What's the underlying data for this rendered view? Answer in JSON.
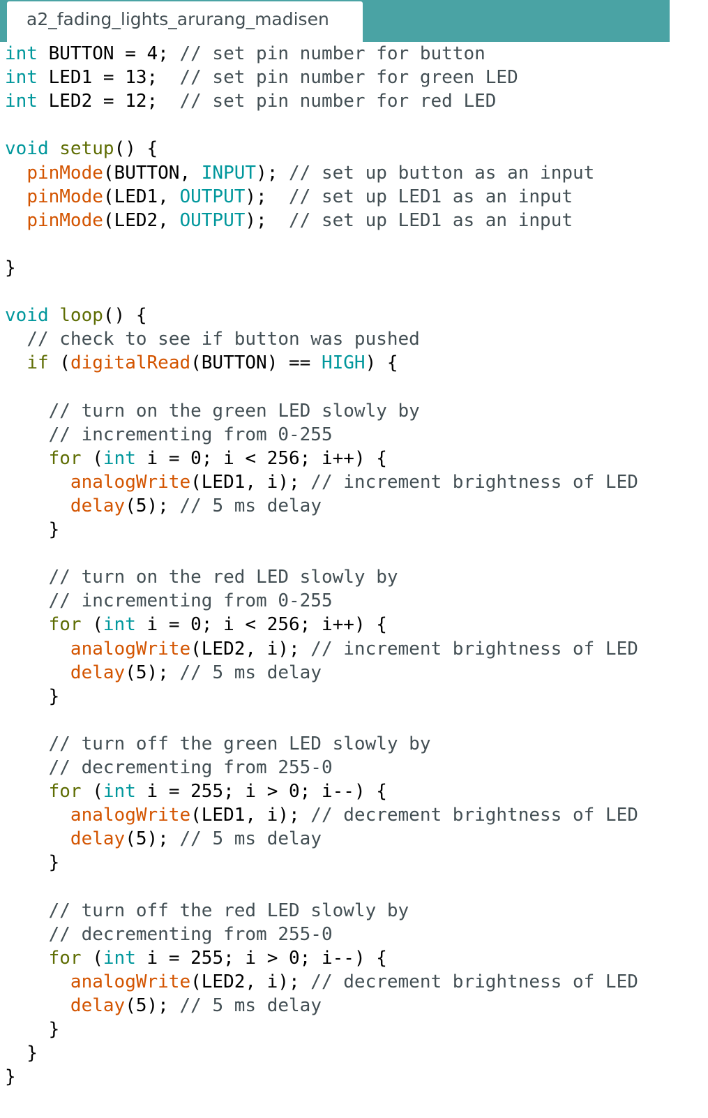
{
  "tab": {
    "title": "a2_fading_lights_arurang_madisen"
  },
  "colors": {
    "tabbar": "#4aa3a4",
    "type": "#00979c",
    "function": "#d35400",
    "constant": "#00979c",
    "keyword": "#5e6d03",
    "comment": "#434f54",
    "text": "#000000"
  },
  "code_lines": [
    [
      [
        "type",
        "int"
      ],
      [
        "plain",
        " BUTTON = 4; "
      ],
      [
        "comment",
        "// set pin number for button"
      ]
    ],
    [
      [
        "type",
        "int"
      ],
      [
        "plain",
        " LED1 = 13;  "
      ],
      [
        "comment",
        "// set pin number for green LED"
      ]
    ],
    [
      [
        "type",
        "int"
      ],
      [
        "plain",
        " LED2 = 12;  "
      ],
      [
        "comment",
        "// set pin number for red LED"
      ]
    ],
    [],
    [
      [
        "type",
        "void"
      ],
      [
        "plain",
        " "
      ],
      [
        "kw",
        "setup"
      ],
      [
        "plain",
        "() {"
      ]
    ],
    [
      [
        "plain",
        "  "
      ],
      [
        "func",
        "pinMode"
      ],
      [
        "plain",
        "(BUTTON, "
      ],
      [
        "const",
        "INPUT"
      ],
      [
        "plain",
        "); "
      ],
      [
        "comment",
        "// set up button as an input"
      ]
    ],
    [
      [
        "plain",
        "  "
      ],
      [
        "func",
        "pinMode"
      ],
      [
        "plain",
        "(LED1, "
      ],
      [
        "const",
        "OUTPUT"
      ],
      [
        "plain",
        ");  "
      ],
      [
        "comment",
        "// set up LED1 as an input"
      ]
    ],
    [
      [
        "plain",
        "  "
      ],
      [
        "func",
        "pinMode"
      ],
      [
        "plain",
        "(LED2, "
      ],
      [
        "const",
        "OUTPUT"
      ],
      [
        "plain",
        ");  "
      ],
      [
        "comment",
        "// set up LED1 as an input"
      ]
    ],
    [],
    [
      [
        "plain",
        "}"
      ]
    ],
    [],
    [
      [
        "type",
        "void"
      ],
      [
        "plain",
        " "
      ],
      [
        "kw",
        "loop"
      ],
      [
        "plain",
        "() {"
      ]
    ],
    [
      [
        "plain",
        "  "
      ],
      [
        "comment",
        "// check to see if button was pushed"
      ]
    ],
    [
      [
        "plain",
        "  "
      ],
      [
        "kw",
        "if"
      ],
      [
        "plain",
        " ("
      ],
      [
        "func",
        "digitalRead"
      ],
      [
        "plain",
        "(BUTTON) == "
      ],
      [
        "const",
        "HIGH"
      ],
      [
        "plain",
        ") {"
      ]
    ],
    [],
    [
      [
        "plain",
        "    "
      ],
      [
        "comment",
        "// turn on the green LED slowly by"
      ]
    ],
    [
      [
        "plain",
        "    "
      ],
      [
        "comment",
        "// incrementing from 0-255"
      ]
    ],
    [
      [
        "plain",
        "    "
      ],
      [
        "kw",
        "for"
      ],
      [
        "plain",
        " ("
      ],
      [
        "type",
        "int"
      ],
      [
        "plain",
        " i = 0; i < 256; i++) {"
      ]
    ],
    [
      [
        "plain",
        "      "
      ],
      [
        "func",
        "analogWrite"
      ],
      [
        "plain",
        "(LED1, i); "
      ],
      [
        "comment",
        "// increment brightness of LED"
      ]
    ],
    [
      [
        "plain",
        "      "
      ],
      [
        "func",
        "delay"
      ],
      [
        "plain",
        "(5); "
      ],
      [
        "comment",
        "// 5 ms delay"
      ]
    ],
    [
      [
        "plain",
        "    }"
      ]
    ],
    [],
    [
      [
        "plain",
        "    "
      ],
      [
        "comment",
        "// turn on the red LED slowly by"
      ]
    ],
    [
      [
        "plain",
        "    "
      ],
      [
        "comment",
        "// incrementing from 0-255"
      ]
    ],
    [
      [
        "plain",
        "    "
      ],
      [
        "kw",
        "for"
      ],
      [
        "plain",
        " ("
      ],
      [
        "type",
        "int"
      ],
      [
        "plain",
        " i = 0; i < 256; i++) {"
      ]
    ],
    [
      [
        "plain",
        "      "
      ],
      [
        "func",
        "analogWrite"
      ],
      [
        "plain",
        "(LED2, i); "
      ],
      [
        "comment",
        "// increment brightness of LED"
      ]
    ],
    [
      [
        "plain",
        "      "
      ],
      [
        "func",
        "delay"
      ],
      [
        "plain",
        "(5); "
      ],
      [
        "comment",
        "// 5 ms delay"
      ]
    ],
    [
      [
        "plain",
        "    }"
      ]
    ],
    [],
    [
      [
        "plain",
        "    "
      ],
      [
        "comment",
        "// turn off the green LED slowly by"
      ]
    ],
    [
      [
        "plain",
        "    "
      ],
      [
        "comment",
        "// decrementing from 255-0"
      ]
    ],
    [
      [
        "plain",
        "    "
      ],
      [
        "kw",
        "for"
      ],
      [
        "plain",
        " ("
      ],
      [
        "type",
        "int"
      ],
      [
        "plain",
        " i = 255; i > 0; i--) {"
      ]
    ],
    [
      [
        "plain",
        "      "
      ],
      [
        "func",
        "analogWrite"
      ],
      [
        "plain",
        "(LED1, i); "
      ],
      [
        "comment",
        "// decrement brightness of LED"
      ]
    ],
    [
      [
        "plain",
        "      "
      ],
      [
        "func",
        "delay"
      ],
      [
        "plain",
        "(5); "
      ],
      [
        "comment",
        "// 5 ms delay"
      ]
    ],
    [
      [
        "plain",
        "    }"
      ]
    ],
    [],
    [
      [
        "plain",
        "    "
      ],
      [
        "comment",
        "// turn off the red LED slowly by"
      ]
    ],
    [
      [
        "plain",
        "    "
      ],
      [
        "comment",
        "// decrementing from 255-0"
      ]
    ],
    [
      [
        "plain",
        "    "
      ],
      [
        "kw",
        "for"
      ],
      [
        "plain",
        " ("
      ],
      [
        "type",
        "int"
      ],
      [
        "plain",
        " i = 255; i > 0; i--) {"
      ]
    ],
    [
      [
        "plain",
        "      "
      ],
      [
        "func",
        "analogWrite"
      ],
      [
        "plain",
        "(LED2, i); "
      ],
      [
        "comment",
        "// decrement brightness of LED"
      ]
    ],
    [
      [
        "plain",
        "      "
      ],
      [
        "func",
        "delay"
      ],
      [
        "plain",
        "(5); "
      ],
      [
        "comment",
        "// 5 ms delay"
      ]
    ],
    [
      [
        "plain",
        "    }"
      ]
    ],
    [
      [
        "plain",
        "  }"
      ]
    ],
    [
      [
        "plain",
        "}"
      ]
    ]
  ]
}
